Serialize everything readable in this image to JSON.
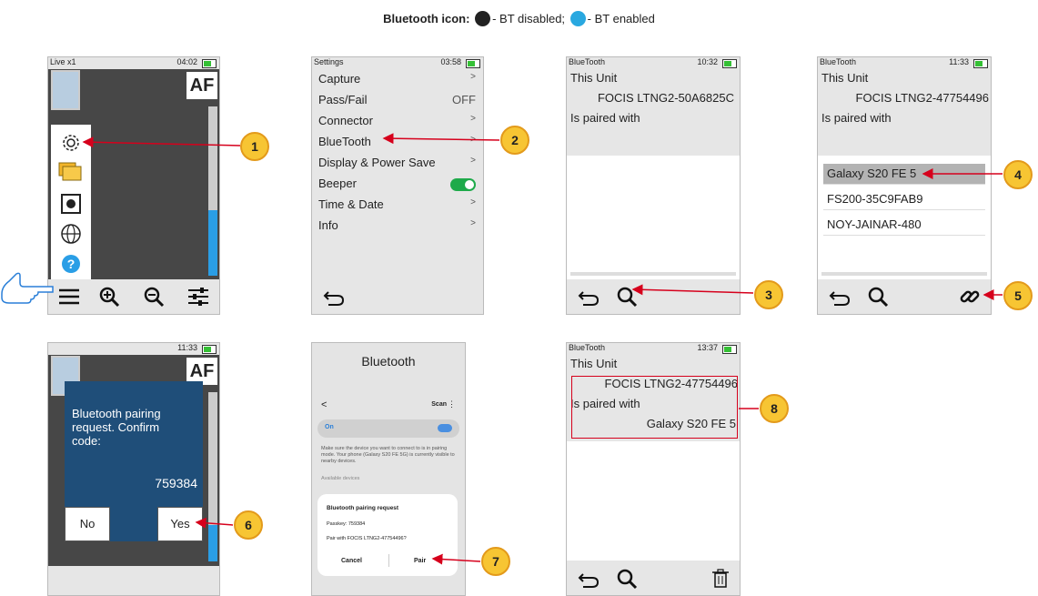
{
  "header": {
    "label": "Bluetooth icon:",
    "disabled": "- BT disabled;",
    "enabled": "- BT enabled"
  },
  "callouts": [
    "1",
    "2",
    "3",
    "4",
    "5",
    "6",
    "7",
    "8"
  ],
  "screen1": {
    "title": "Live x1",
    "time": "04:02",
    "af": "AF"
  },
  "screen2": {
    "title": "Settings",
    "time": "03:58",
    "items": [
      {
        "label": "Capture",
        "value": ">"
      },
      {
        "label": "Pass/Fail",
        "value": "OFF"
      },
      {
        "label": "Connector",
        "value": ">"
      },
      {
        "label": "BlueTooth",
        "value": ">"
      },
      {
        "label": "Display & Power Save",
        "value": ">"
      },
      {
        "label": "Beeper",
        "value": ""
      },
      {
        "label": "Time & Date",
        "value": ">"
      },
      {
        "label": "Info",
        "value": ">"
      }
    ]
  },
  "screen3": {
    "title": "BlueTooth",
    "time": "10:32",
    "this_unit": "This Unit",
    "unit_name": "FOCIS LTNG2-50A6825C",
    "paired": "Is paired with"
  },
  "screen4": {
    "title": "BlueTooth",
    "time": "11:33",
    "this_unit": "This Unit",
    "unit_name": "FOCIS LTNG2-47754496",
    "paired": "Is paired with",
    "devices": [
      "Galaxy S20 FE 5",
      "FS200-35C9FAB9",
      "NOY-JAINAR-480"
    ]
  },
  "screen5": {
    "time": "11:33",
    "af": "AF",
    "dialog_title": "Bluetooth pairing request. Confirm code:",
    "code": "759384",
    "no": "No",
    "yes": "Yes"
  },
  "screen6": {
    "title": "Bluetooth",
    "scan": "Scan",
    "on": "On",
    "info": "Make sure the device you want to connect to is in pairing mode. Your phone (Galaxy S20 FE 5G) is currently visible to nearby devices.",
    "available": "Available devices",
    "dialog_title": "Bluetooth pairing request",
    "passkey": "Passkey: 759384",
    "pair_with": "Pair with FOCIS LTNG2-47754496?",
    "cancel": "Cancel",
    "pair": "Pair"
  },
  "screen7": {
    "title": "BlueTooth",
    "time": "13:37",
    "this_unit": "This Unit",
    "unit_name": "FOCIS LTNG2-47754496",
    "paired": "Is paired with",
    "paired_device": "Galaxy S20 FE 5"
  },
  "colors": {
    "accent_red": "#d6001c",
    "badge": "#f7c533",
    "bt_blue": "#29a8e0",
    "dialog": "#1f4e79"
  }
}
